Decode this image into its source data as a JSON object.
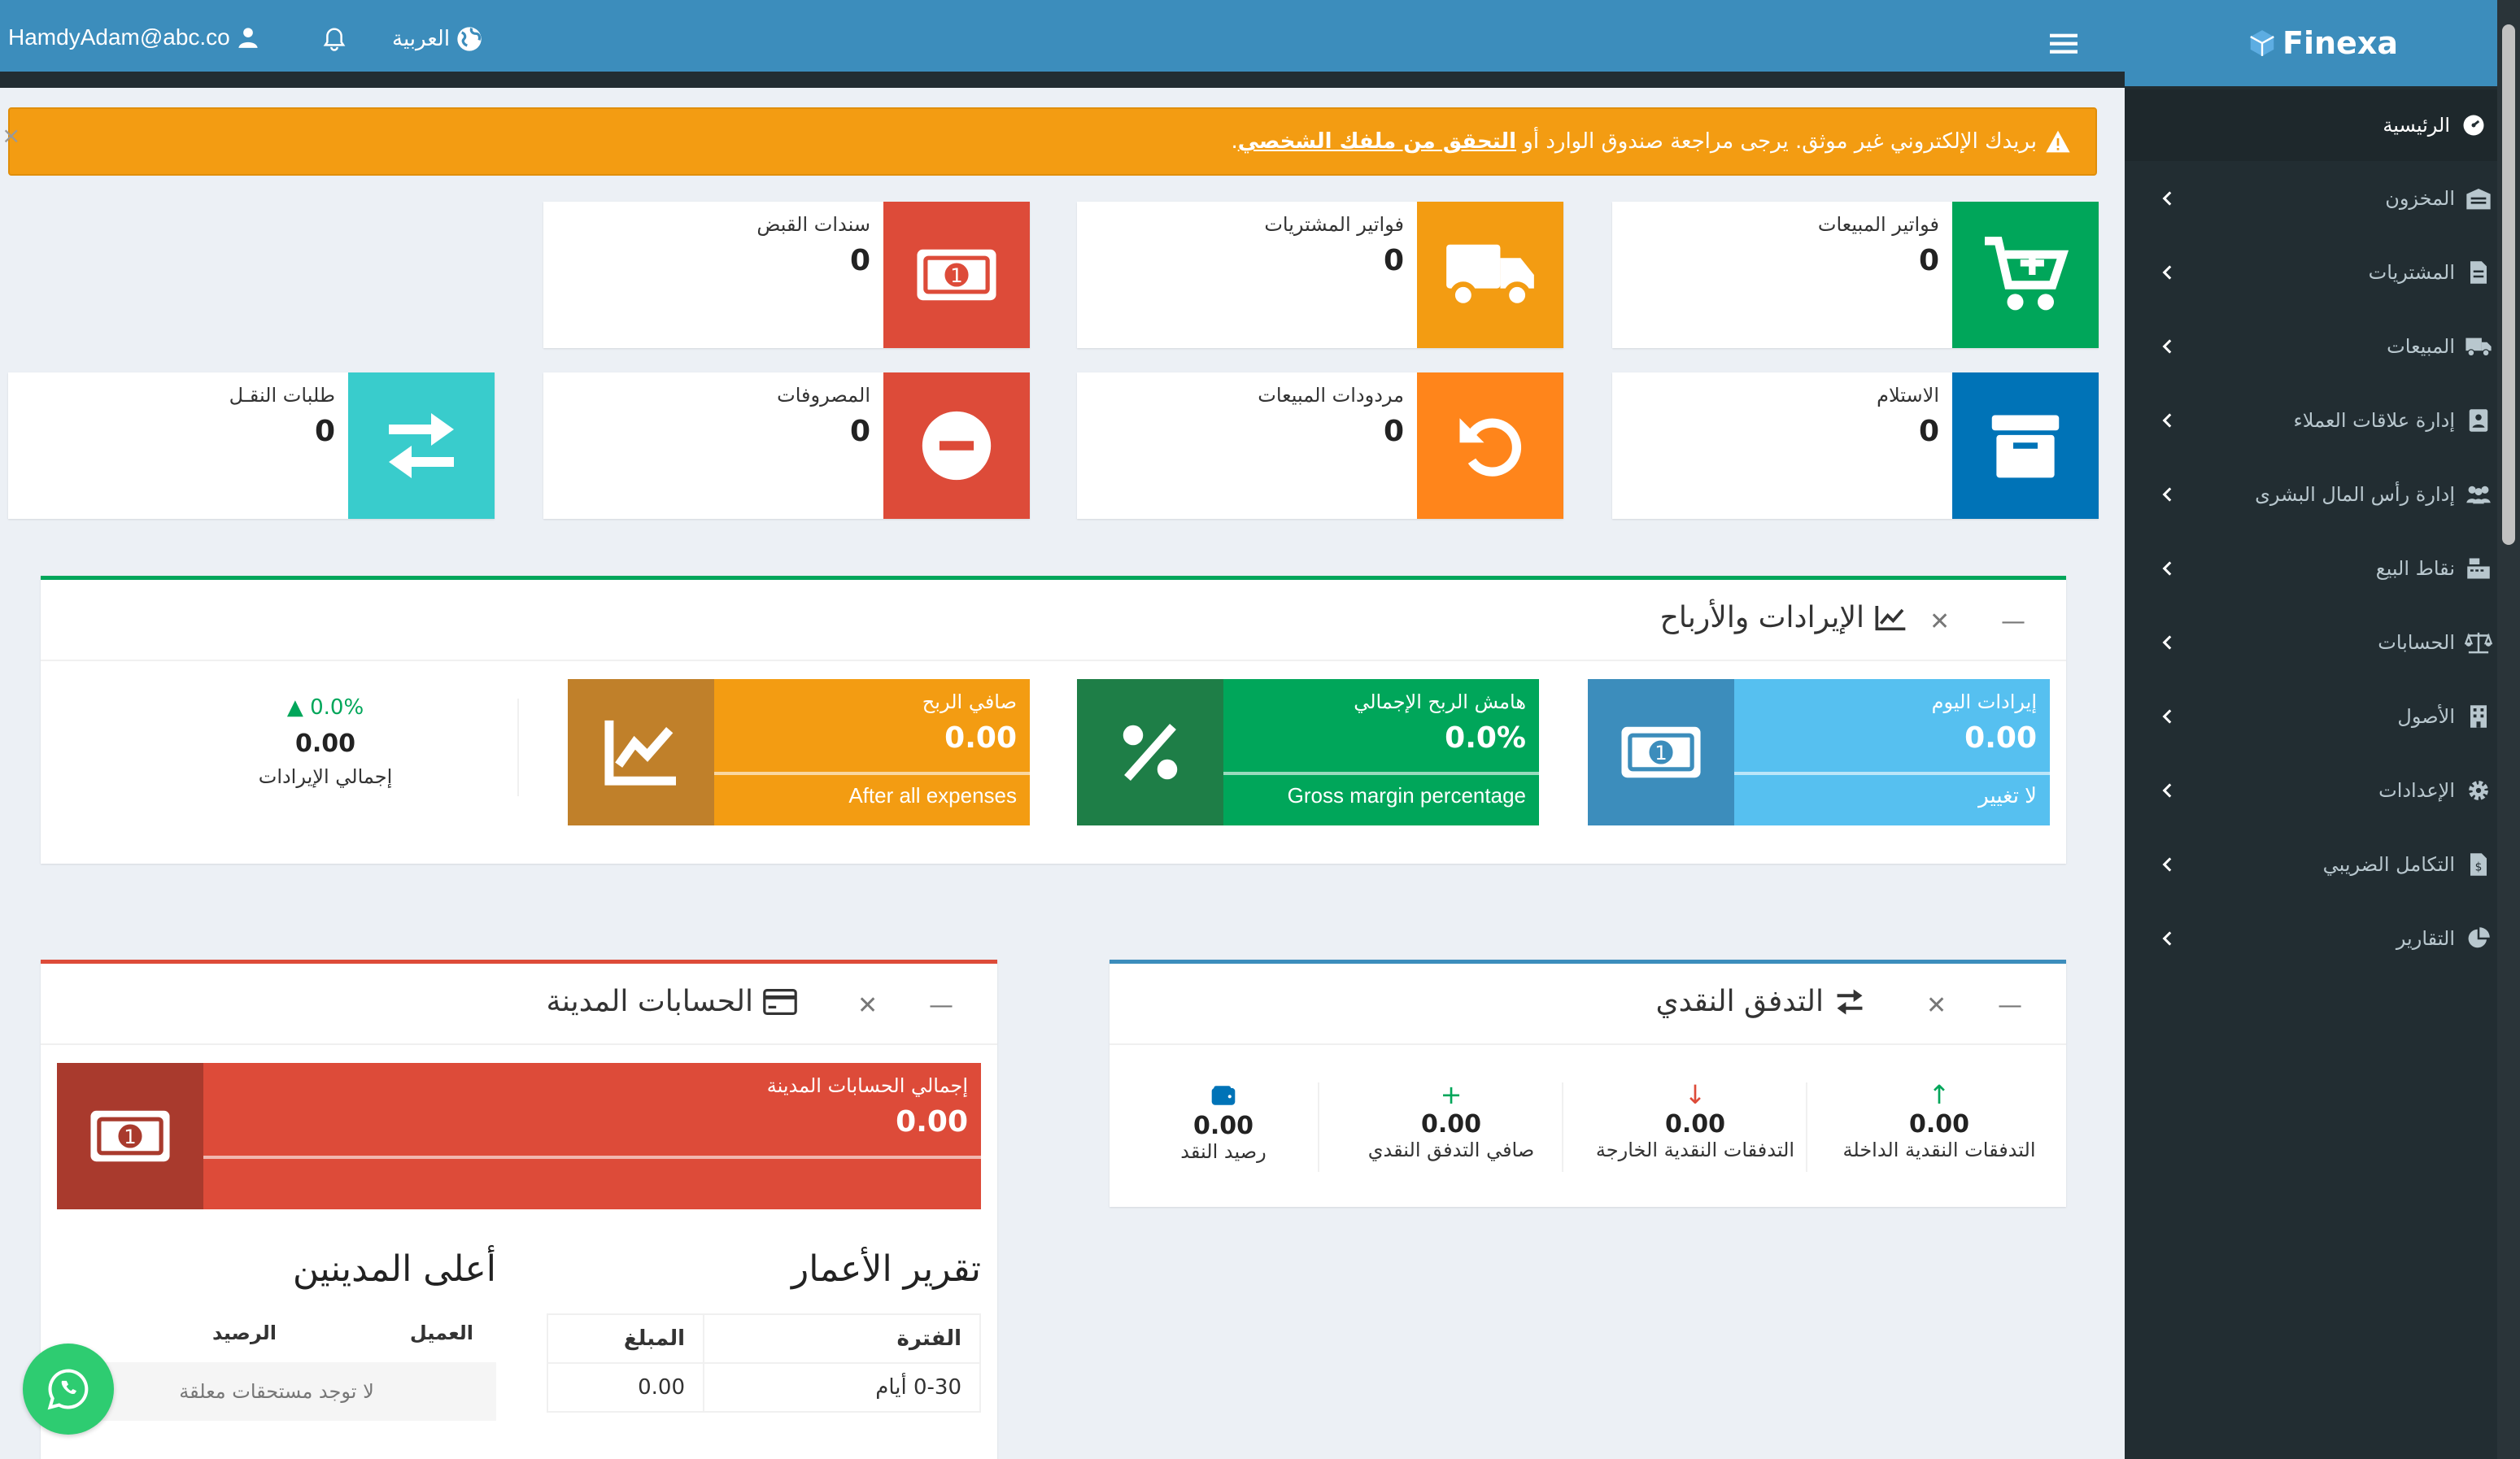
{
  "brand": {
    "name": "Finexa"
  },
  "topbar": {
    "user_email": "HamdyAdam@abc.co",
    "language": "العربية"
  },
  "alert": {
    "text_before": "بريدك الإلكتروني غير موثق. يرجى مراجعة صندوق الوارد أو",
    "link": "التحقق من ملفك الشخصي",
    "text_after": "."
  },
  "sidebar": {
    "items": [
      {
        "label": "الرئيسية",
        "icon": "dashboard-icon"
      },
      {
        "label": "المخزون",
        "icon": "warehouse-icon"
      },
      {
        "label": "المشتريات",
        "icon": "receipt-icon"
      },
      {
        "label": "المبيعات",
        "icon": "truck-icon"
      },
      {
        "label": "إدارة علاقات العملاء",
        "icon": "contact-card-icon"
      },
      {
        "label": "إدارة رأس المال البشرى",
        "icon": "people-icon"
      },
      {
        "label": "نقاط البيع",
        "icon": "cash-register-icon"
      },
      {
        "label": "الحسابات",
        "icon": "scale-icon"
      },
      {
        "label": "الأصول",
        "icon": "building-icon"
      },
      {
        "label": "الإعدادات",
        "icon": "gear-icon"
      },
      {
        "label": "التكامل الضريبي",
        "icon": "tax-file-icon"
      },
      {
        "label": "التقارير",
        "icon": "pie-chart-icon"
      }
    ]
  },
  "info_boxes": [
    {
      "label": "فواتير المبيعات",
      "value": "0",
      "color": "#00a65a"
    },
    {
      "label": "فواتير المشتريات",
      "value": "0",
      "color": "#f39c12"
    },
    {
      "label": "سندات القبض",
      "value": "0",
      "color": "#dd4b39"
    },
    {
      "label": "الاستلام",
      "value": "0",
      "color": "#0073b7"
    },
    {
      "label": "مردودات المبيعات",
      "value": "0",
      "color": "#ff851b"
    },
    {
      "label": "المصروفات",
      "value": "0",
      "color": "#dd4b39"
    },
    {
      "label": "طلبات النقـل",
      "value": "0",
      "color": "#39cccc"
    }
  ],
  "revenue_panel": {
    "title": "الإيرادات والأرباح",
    "today": {
      "label": "إيرادات اليوم",
      "value": "0.00",
      "foot": "لا تغيير"
    },
    "gross": {
      "label": "هامش الربح الإجمالي",
      "value": "0.0%",
      "foot": "Gross margin percentage"
    },
    "net": {
      "label": "صافي الربح",
      "value": "0.00",
      "foot": "After all expenses"
    },
    "total": {
      "change": "0.0%",
      "value": "0.00",
      "label": "إجمالي الإيرادات"
    }
  },
  "cashflow_panel": {
    "title": "التدفق النقدي",
    "items": [
      {
        "value": "0.00",
        "label": "التدفقات النقدية الداخلة"
      },
      {
        "value": "0.00",
        "label": "التدفقات النقدية الخارجة"
      },
      {
        "value": "0.00",
        "label": "صافي التدفق النقدي"
      },
      {
        "value": "0.00",
        "label": "رصيد النقد"
      }
    ]
  },
  "debt_panel": {
    "title": "الحسابات المدينة",
    "total_label": "إجمالي الحسابات المدينة",
    "total_value": "0.00",
    "aging_title": "تقرير الأعمار",
    "aging_headers": [
      "الفترة",
      "المبلغ"
    ],
    "aging_rows": [
      {
        "period": "0-30 أيام",
        "amount": "0.00"
      }
    ],
    "top_title": "أعلى المدينين",
    "top_headers": [
      "العميل",
      "الرصيد"
    ],
    "top_empty": "لا توجد مستحقات معلقة"
  }
}
